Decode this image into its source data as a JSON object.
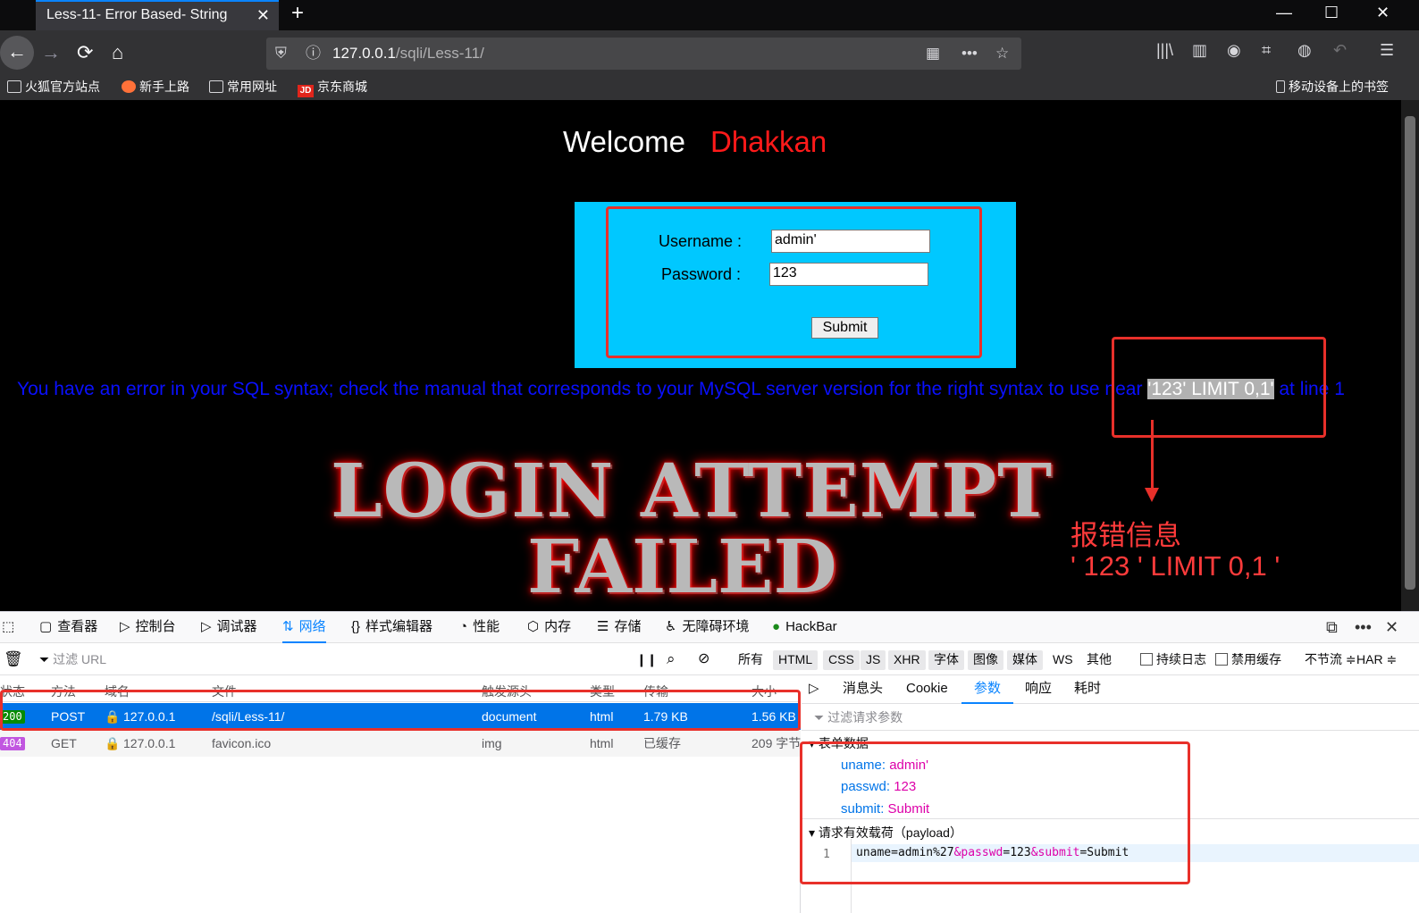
{
  "tab": {
    "title": "Less-11- Error Based- String",
    "close": "✕",
    "new": "+"
  },
  "window": {
    "minimize": "—",
    "maximize": "☐",
    "close": "✕"
  },
  "url": {
    "host": "127.0.0.1",
    "path": "/sqli/Less-11/"
  },
  "bookmarks": [
    {
      "label": "火狐官方站点"
    },
    {
      "label": "新手上路"
    },
    {
      "label": "常用网址"
    },
    {
      "label": "京东商城"
    }
  ],
  "bookmarks_right": "移动设备上的书签",
  "page": {
    "welcome": "Welcome",
    "name": "Dhakkan",
    "username_label": "Username :",
    "username_value": "admin'",
    "password_label": "Password :",
    "password_value": "123",
    "submit": "Submit",
    "error_before": "You have an error in your SQL syntax; check the manual that corresponds to your MySQL server version for the right syntax to use near ",
    "error_highlight": "'123' LIMIT 0,1'",
    "error_after": " at line 1",
    "failed_line1": "LOGIN ATTEMPT",
    "failed_line2": "FAILED",
    "annotation_title": "报错信息",
    "annotation_text": "' 123 ' LIMIT 0,1 '"
  },
  "devtools": {
    "tabs": [
      "查看器",
      "控制台",
      "调试器",
      "网络",
      "样式编辑器",
      "性能",
      "内存",
      "存储",
      "无障碍环境",
      "HackBar"
    ],
    "active_tab": "网络",
    "filter_placeholder": "过滤 URL",
    "type_filters": [
      "所有",
      "HTML",
      "CSS",
      "JS",
      "XHR",
      "字体",
      "图像",
      "媒体",
      "WS",
      "其他"
    ],
    "persist_log": "持续日志",
    "disable_cache": "禁用缓存",
    "throttle": "不节流 ≑",
    "har": "HAR ≑",
    "columns": [
      "状态",
      "方法",
      "域名",
      "文件",
      "触发源头",
      "类型",
      "传输",
      "大小"
    ],
    "rows": [
      {
        "status": "200",
        "method": "POST",
        "domain": "127.0.0.1",
        "file": "/sqli/Less-11/",
        "cause": "document",
        "type": "html",
        "transferred": "1.79 KB",
        "size": "1.56 KB"
      },
      {
        "status": "404",
        "method": "GET",
        "domain": "127.0.0.1",
        "file": "favicon.ico",
        "cause": "img",
        "type": "html",
        "transferred": "已缓存",
        "size": "209 字节"
      }
    ],
    "side_tabs": [
      "消息头",
      "Cookie",
      "参数",
      "响应",
      "耗时"
    ],
    "side_active": "参数",
    "side_filter": "过滤请求参数",
    "form_section": "表单数据",
    "form": [
      {
        "k": "uname",
        "v": "admin'"
      },
      {
        "k": "passwd",
        "v": "123"
      },
      {
        "k": "submit",
        "v": "Submit"
      }
    ],
    "payload_section": "请求有效载荷（payload）",
    "payload_line": "1",
    "payload": {
      "a": "uname=admin%27",
      "b": "&passwd",
      "c": "=123",
      "d": "&submit",
      "e": "=Submit"
    }
  },
  "colors": {
    "accent": "#0a84ff",
    "annotation": "#e8302a",
    "login_box": "#00c8ff"
  }
}
